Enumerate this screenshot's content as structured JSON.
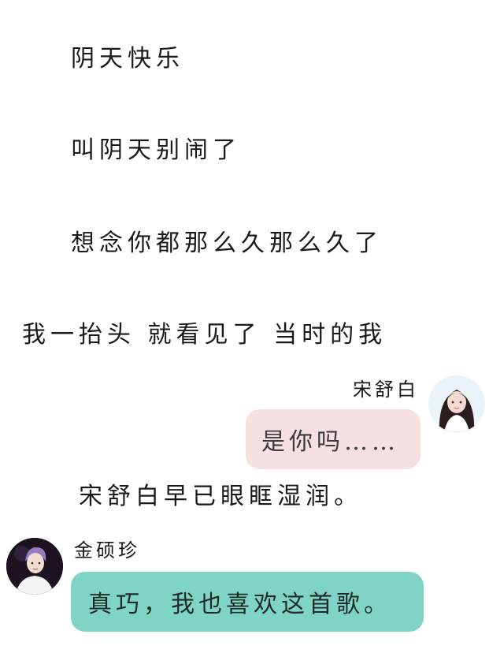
{
  "lyrics": [
    "阴天快乐",
    "叫阴天别闹了",
    "想念你都那么久那么久了",
    "我一抬头 就看见了 当时的我"
  ],
  "messages": [
    {
      "sender": "宋舒白",
      "text": "是你吗……",
      "side": "right",
      "bubble_color": "#f6e0e1"
    },
    {
      "sender": "金硕珍",
      "text": "真巧，我也喜欢这首歌。",
      "side": "left",
      "bubble_color": "#7fd4c5"
    }
  ],
  "narration": "宋舒白早已眼眶湿润。"
}
